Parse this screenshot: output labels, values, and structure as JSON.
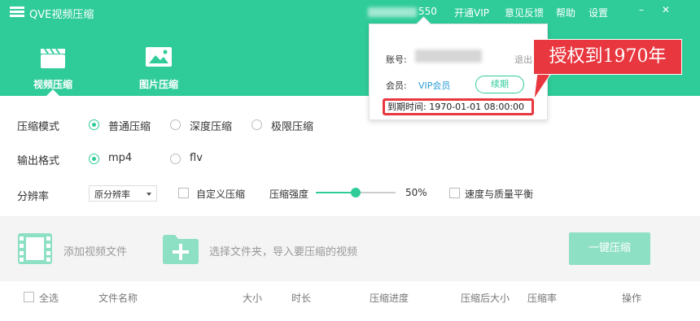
{
  "app": {
    "title": "QVE视频压缩"
  },
  "titlebar": {
    "account_suffix": "550",
    "menus": [
      "开通VIP",
      "意见反馈",
      "帮助",
      "设置"
    ],
    "minimize": "–",
    "close": "✕"
  },
  "nav": {
    "tabs": [
      {
        "label": "视频压缩",
        "icon": "clapperboard-icon",
        "active": true
      },
      {
        "label": "图片压缩",
        "icon": "image-icon",
        "active": false
      }
    ]
  },
  "settings": {
    "mode_label": "压缩模式",
    "modes": [
      {
        "label": "普通压缩",
        "checked": true
      },
      {
        "label": "深度压缩",
        "checked": false
      },
      {
        "label": "极限压缩",
        "checked": false
      }
    ],
    "format_label": "输出格式",
    "formats": [
      {
        "label": "mp4",
        "checked": true
      },
      {
        "label": "flv",
        "checked": false
      }
    ],
    "resolution_label": "分辨率",
    "resolution_value": "原分辨率",
    "custom_label": "自定义压缩",
    "strength_label": "压缩强度",
    "strength_value": "50%",
    "strength_fraction": 0.5,
    "balance_label": "速度与质量平衡"
  },
  "droparea": {
    "add_video": "添加视频文件",
    "select_folder": "选择文件夹，导入要压缩的视频",
    "compress_button": "一键压缩"
  },
  "table": {
    "select_all": "全选",
    "columns": [
      "文件名称",
      "大小",
      "时长",
      "压缩进度",
      "压缩后大小",
      "压缩率",
      "操作"
    ]
  },
  "popup": {
    "account_label": "账号:",
    "logout": "退出",
    "member_label": "会员:",
    "member_type": "VIP会员",
    "renew_button": "续期",
    "expire": "到期时间: 1970-01-01 08:00:00"
  },
  "callout": {
    "text": "授权到1970年"
  },
  "colors": {
    "accent": "#2fcc9a",
    "highlight": "#e8373f",
    "link": "#2a9ed6"
  }
}
